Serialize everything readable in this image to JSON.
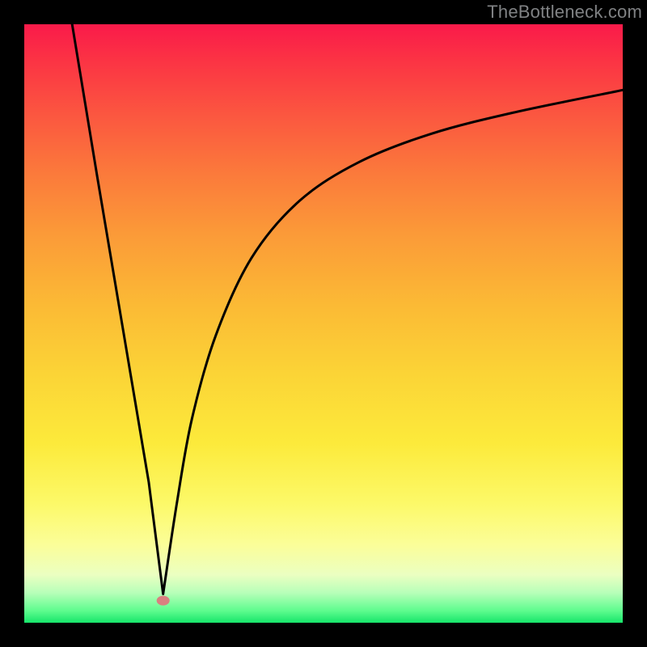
{
  "attribution": "TheBottleneck.com",
  "dot_color": "#d98080",
  "curve_color": "#000000",
  "chart_data": {
    "type": "line",
    "title": "",
    "xlabel": "",
    "ylabel": "",
    "xlim": [
      0,
      1
    ],
    "ylim": [
      0,
      1
    ],
    "series": [
      {
        "name": "left-arm",
        "x": [
          0.08,
          0.122,
          0.165,
          0.208,
          0.232
        ],
        "values": [
          1.0,
          0.745,
          0.49,
          0.235,
          0.048
        ]
      },
      {
        "name": "right-arm",
        "x": [
          0.232,
          0.255,
          0.28,
          0.32,
          0.38,
          0.46,
          0.56,
          0.68,
          0.82,
          1.0
        ],
        "values": [
          0.048,
          0.2,
          0.34,
          0.48,
          0.61,
          0.705,
          0.77,
          0.817,
          0.853,
          0.89
        ]
      }
    ],
    "annotations": [
      {
        "type": "marker",
        "x": 0.232,
        "y": 0.037,
        "label": "minimum-dot"
      }
    ]
  }
}
